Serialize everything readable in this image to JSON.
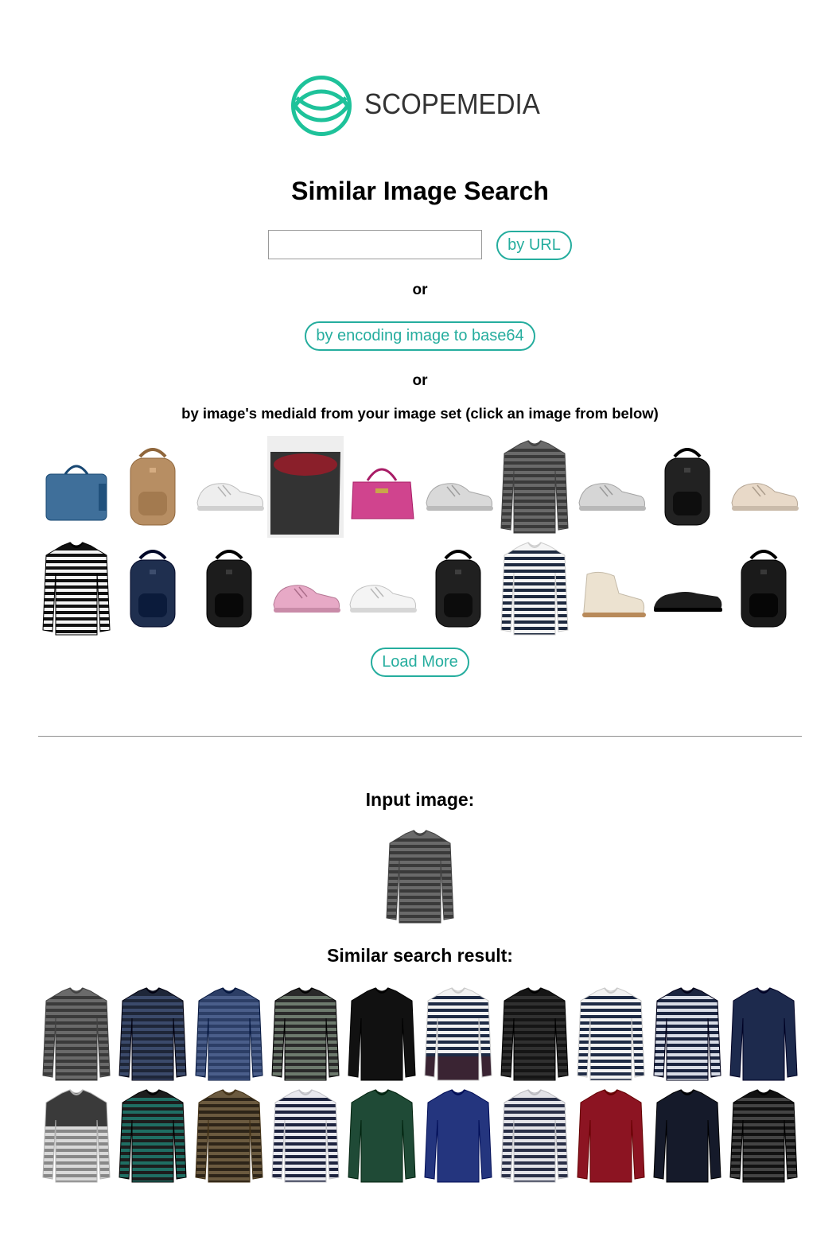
{
  "brand": {
    "name": "SCOPEMEDIA",
    "accent": "#25ad9e",
    "logo_color": "#1ec29a",
    "icon": "fish-circle-logo"
  },
  "page_title": "Similar Image Search",
  "search": {
    "url_value": "",
    "url_placeholder": "",
    "by_url_label": "by URL",
    "or_label": "or",
    "by_base64_label": "by encoding image to base64",
    "by_mediaid_label": "by image's mediaId from your image set (click an image from below)",
    "load_more_label": "Load More"
  },
  "image_set": [
    {
      "kind": "bag",
      "color": "#3f6f9a"
    },
    {
      "kind": "backpack",
      "color": "#b78e63"
    },
    {
      "kind": "sneaker",
      "color": "#eeeeee"
    },
    {
      "kind": "bucket-bag",
      "color": "#333333"
    },
    {
      "kind": "handbag",
      "color": "#d0448e"
    },
    {
      "kind": "sneaker",
      "color": "#d9d9d9"
    },
    {
      "kind": "sweater",
      "color": "#6a6a6a",
      "stripe": "#3a3a3a"
    },
    {
      "kind": "sneaker",
      "color": "#d6d6d6"
    },
    {
      "kind": "backpack",
      "color": "#222222"
    },
    {
      "kind": "sneaker",
      "color": "#e8d9c8"
    },
    {
      "kind": "sweater",
      "color": "#111111",
      "stripe": "#f5f5f5"
    },
    {
      "kind": "backpack",
      "color": "#1f2f4f"
    },
    {
      "kind": "backpack",
      "color": "#1c1c1c"
    },
    {
      "kind": "sneaker",
      "color": "#e7a9c6"
    },
    {
      "kind": "sneaker",
      "color": "#f4f4f4"
    },
    {
      "kind": "backpack",
      "color": "#202020"
    },
    {
      "kind": "sweater",
      "color": "#f5f5f5",
      "stripe": "#1e2a40"
    },
    {
      "kind": "boot",
      "color": "#ece2d0"
    },
    {
      "kind": "shoe",
      "color": "#1c1c1c"
    },
    {
      "kind": "backpack",
      "color": "#1a1a1a"
    }
  ],
  "input_section": {
    "title": "Input image:",
    "image": {
      "kind": "sweater",
      "color": "#6a6a6a",
      "stripe": "#3a3a3a"
    }
  },
  "results_section": {
    "title": "Similar search result:",
    "images": [
      {
        "kind": "sweater",
        "color": "#6a6a6a",
        "stripe": "#3a3a3a"
      },
      {
        "kind": "sweater",
        "color": "#1e2638",
        "stripe": "#3b4a6b"
      },
      {
        "kind": "sweater",
        "color": "#2c3e66",
        "stripe": "#4a5e8a"
      },
      {
        "kind": "sweater",
        "color": "#2a2a2a",
        "stripe": "#6d7a6d"
      },
      {
        "kind": "sweater",
        "color": "#111111"
      },
      {
        "kind": "sweater",
        "color": "#f2f2f2",
        "stripe": "#1e2b45",
        "bottom": "#3a2433"
      },
      {
        "kind": "sweater",
        "color": "#151515",
        "stripe": "#303030"
      },
      {
        "kind": "sweater",
        "color": "#f2f2f2",
        "stripe": "#1e2b45"
      },
      {
        "kind": "sweater",
        "color": "#1b2540",
        "stripe": "#d8dce6"
      },
      {
        "kind": "sweater",
        "color": "#1d2a4d"
      },
      {
        "kind": "sweater",
        "color": "#d9d9d9",
        "top": "#3a3a3a",
        "stripe": "#888888"
      },
      {
        "kind": "sweater",
        "color": "#1d1d1d",
        "stripe": "#1f6e63"
      },
      {
        "kind": "sweater",
        "color": "#6b5a3f",
        "stripe": "#2d2418"
      },
      {
        "kind": "sweater",
        "color": "#e8e8ee",
        "stripe": "#1e2440"
      },
      {
        "kind": "sweater",
        "color": "#1f4a36"
      },
      {
        "kind": "sweater",
        "color": "#24357e"
      },
      {
        "kind": "sweater",
        "color": "#e3e3e8",
        "stripe": "#2a3048"
      },
      {
        "kind": "sweater",
        "color": "#8c1422"
      },
      {
        "kind": "sweater",
        "color": "#151a2a"
      },
      {
        "kind": "sweater",
        "color": "#111111",
        "stripe": "#444444"
      }
    ]
  }
}
